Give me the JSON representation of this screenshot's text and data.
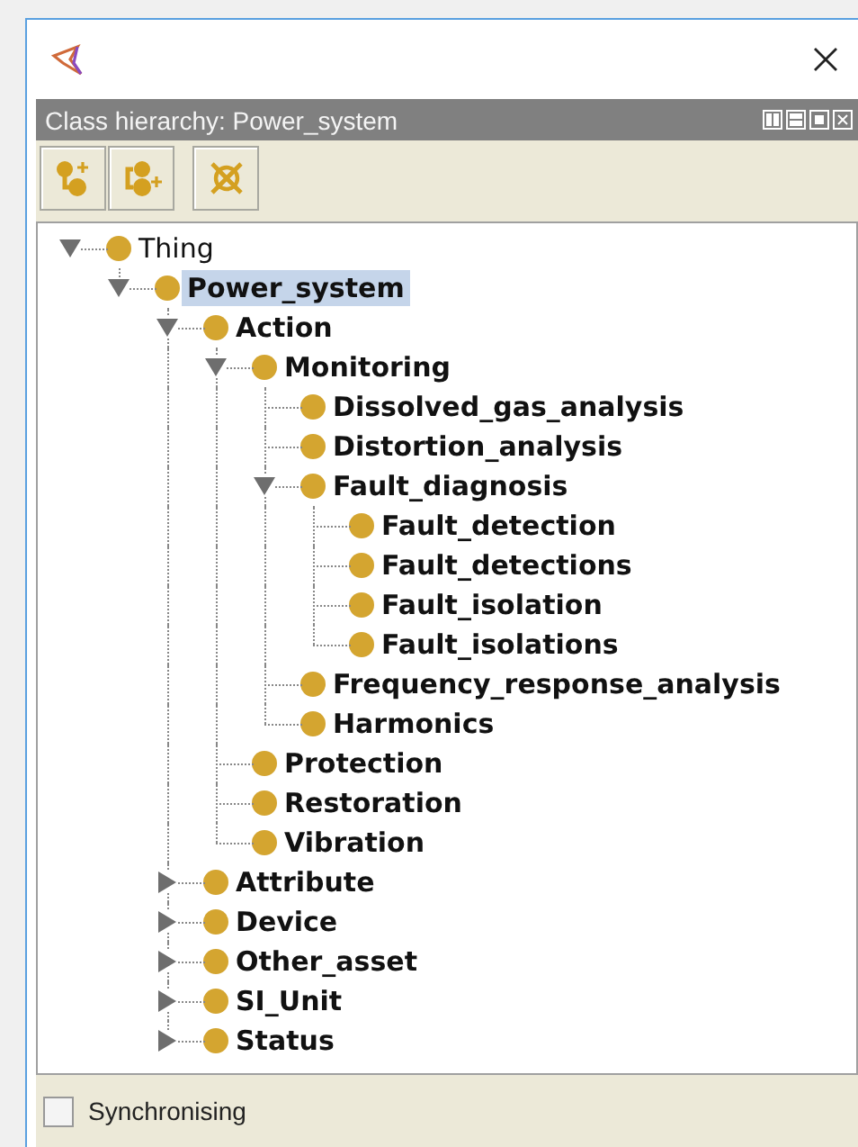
{
  "view": {
    "title": "Class hierarchy: Power_system"
  },
  "tree": [
    {
      "label": "Thing",
      "bold": false,
      "selected": false,
      "kind": "branch",
      "expanded": true,
      "children": [
        {
          "label": "Power_system",
          "bold": true,
          "selected": true,
          "kind": "branch",
          "expanded": true,
          "children": [
            {
              "label": "Action",
              "bold": true,
              "selected": false,
              "kind": "branch",
              "expanded": true,
              "children": [
                {
                  "label": "Monitoring",
                  "bold": true,
                  "selected": false,
                  "kind": "branch",
                  "expanded": true,
                  "children": [
                    {
                      "label": "Dissolved_gas_analysis",
                      "bold": true,
                      "selected": false,
                      "kind": "leaf"
                    },
                    {
                      "label": "Distortion_analysis",
                      "bold": true,
                      "selected": false,
                      "kind": "leaf"
                    },
                    {
                      "label": "Fault_diagnosis",
                      "bold": true,
                      "selected": false,
                      "kind": "branch",
                      "expanded": true,
                      "children": [
                        {
                          "label": "Fault_detection",
                          "bold": true,
                          "selected": false,
                          "kind": "leaf"
                        },
                        {
                          "label": "Fault_detections",
                          "bold": true,
                          "selected": false,
                          "kind": "leaf"
                        },
                        {
                          "label": "Fault_isolation",
                          "bold": true,
                          "selected": false,
                          "kind": "leaf"
                        },
                        {
                          "label": "Fault_isolations",
                          "bold": true,
                          "selected": false,
                          "kind": "leaf"
                        }
                      ]
                    },
                    {
                      "label": "Frequency_response_analysis",
                      "bold": true,
                      "selected": false,
                      "kind": "leaf"
                    },
                    {
                      "label": "Harmonics",
                      "bold": true,
                      "selected": false,
                      "kind": "leaf"
                    }
                  ]
                },
                {
                  "label": "Protection",
                  "bold": true,
                  "selected": false,
                  "kind": "leaf"
                },
                {
                  "label": "Restoration",
                  "bold": true,
                  "selected": false,
                  "kind": "leaf"
                },
                {
                  "label": "Vibration",
                  "bold": true,
                  "selected": false,
                  "kind": "leaf"
                }
              ]
            },
            {
              "label": "Attribute",
              "bold": true,
              "selected": false,
              "kind": "branch",
              "expanded": false
            },
            {
              "label": "Device",
              "bold": true,
              "selected": false,
              "kind": "branch",
              "expanded": false
            },
            {
              "label": "Other_asset",
              "bold": true,
              "selected": false,
              "kind": "branch",
              "expanded": false
            },
            {
              "label": "SI_Unit",
              "bold": true,
              "selected": false,
              "kind": "branch",
              "expanded": false
            },
            {
              "label": "Status",
              "bold": true,
              "selected": false,
              "kind": "branch",
              "expanded": false
            }
          ]
        }
      ]
    }
  ],
  "sync": {
    "label": "Synchronising",
    "checked": false
  }
}
